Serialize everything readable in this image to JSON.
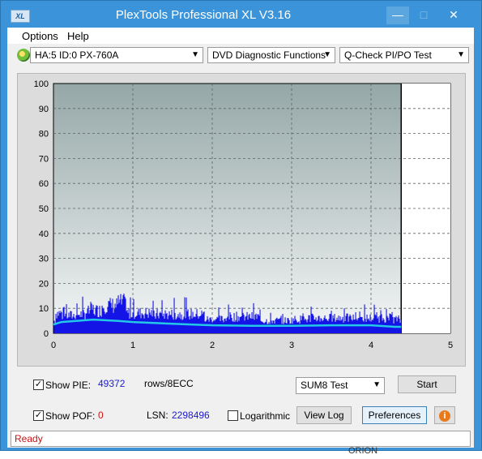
{
  "window": {
    "title": "PlexTools Professional XL V3.16",
    "app_icon": "XL"
  },
  "menu": {
    "options": "Options",
    "help": "Help"
  },
  "toolbar": {
    "drive": "HA:5 ID:0  PX-760A",
    "function": "DVD Diagnostic Functions",
    "test": "Q-Check PI/PO Test"
  },
  "chart_data": {
    "type": "area",
    "xlim": [
      0,
      5
    ],
    "ylim": [
      0,
      100
    ],
    "x_ticks": [
      "0",
      "1",
      "2",
      "3",
      "4",
      "5"
    ],
    "y_ticks": [
      "0",
      "10",
      "20",
      "30",
      "40",
      "50",
      "60",
      "70",
      "80",
      "90",
      "100"
    ],
    "grid": true,
    "data_end_x": 4.38,
    "series": [
      {
        "color": "#1414e6",
        "peak_points": [
          [
            0.02,
            16
          ],
          [
            0.1,
            14
          ],
          [
            0.25,
            15
          ],
          [
            0.4,
            17
          ],
          [
            0.45,
            19
          ],
          [
            0.5,
            18
          ],
          [
            0.6,
            22
          ],
          [
            0.8,
            24
          ],
          [
            0.9,
            16
          ],
          [
            1.25,
            14
          ],
          [
            1.3,
            15
          ],
          [
            1.9,
            11
          ],
          [
            2.15,
            13
          ],
          [
            2.6,
            10
          ],
          [
            3.0,
            11
          ],
          [
            3.2,
            12
          ],
          [
            4.25,
            11
          ],
          [
            4.35,
            10
          ]
        ]
      },
      {
        "color": "#22c8e6",
        "points": [
          [
            0,
            3.5
          ],
          [
            0.1,
            4.5
          ],
          [
            0.3,
            5
          ],
          [
            0.5,
            5.5
          ],
          [
            0.8,
            5
          ],
          [
            1.0,
            4.5
          ],
          [
            1.5,
            3.8
          ],
          [
            2.0,
            3.2
          ],
          [
            2.5,
            3
          ],
          [
            3.0,
            3
          ],
          [
            3.5,
            3.2
          ],
          [
            4.0,
            3.2
          ],
          [
            4.3,
            2.6
          ],
          [
            4.38,
            2.6
          ]
        ]
      }
    ]
  },
  "controls": {
    "show_pie_label": "Show PIE:",
    "pie_value": "49372",
    "rows_label": "rows/8ECC",
    "show_pof_label": "Show POF:",
    "pof_value": "0",
    "lsn_label": "LSN:",
    "lsn_value": "2298496",
    "logarithmic_label": "Logarithmic",
    "sum_select": "SUM8 Test",
    "start": "Start",
    "view_log": "View Log",
    "preferences": "Preferences"
  },
  "status": {
    "text": "Ready"
  },
  "background": {
    "partial_text": "ORION"
  }
}
